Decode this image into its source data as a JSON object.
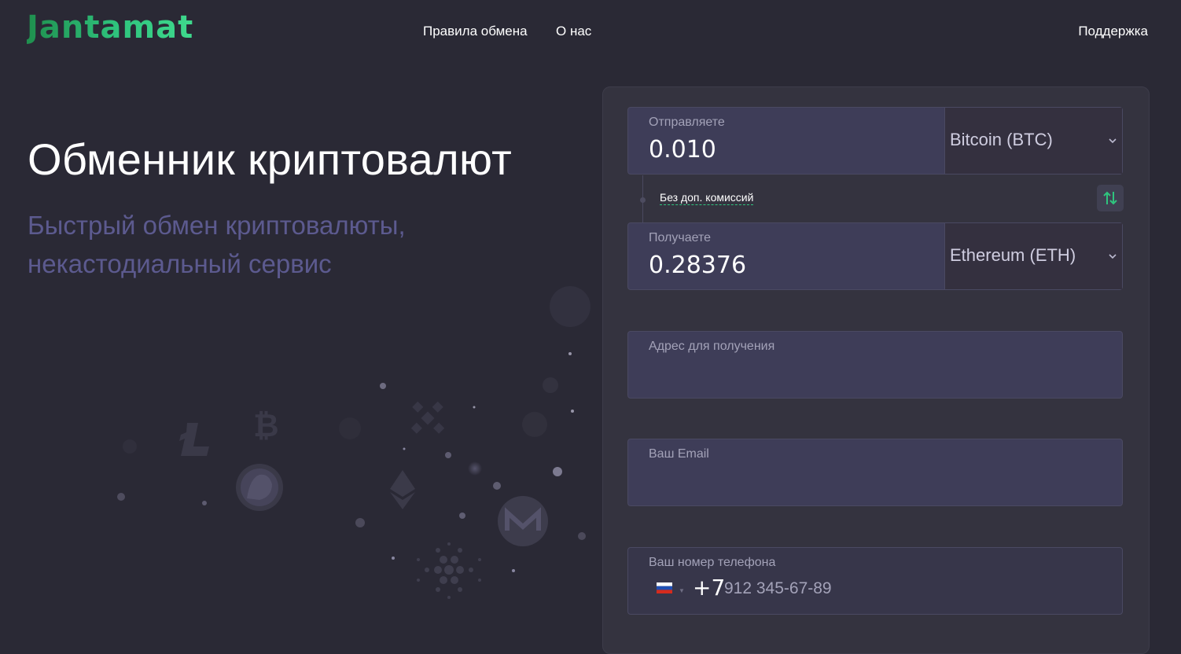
{
  "brand": {
    "logo": "Jantamat",
    "accent": "#2fc47e"
  },
  "nav": {
    "rules": "Правила обмена",
    "about": "О нас",
    "support": "Поддержка"
  },
  "hero": {
    "title": "Обменник криптовалют",
    "subtitle": "Быстрый обмен криптовалюты, некастодиальный сервис"
  },
  "exchange": {
    "send": {
      "label": "Отправляете",
      "value": "0.010",
      "currency": "Bitcoin (BTC)"
    },
    "commission": "Без доп. комиссий",
    "swap_icon": "swap-arrows-icon",
    "receive": {
      "label": "Получаете",
      "value": "0.28376",
      "currency": "Ethereum (ETH)"
    },
    "address": {
      "label": "Адрес для получения",
      "value": ""
    },
    "email": {
      "label": "Ваш Email",
      "value": ""
    },
    "phone": {
      "label": "Ваш номер телефона",
      "country_icon": "russia-flag-icon",
      "code": "+7",
      "placeholder": "912 345-67-89"
    }
  },
  "decor_icons": [
    "litecoin-icon",
    "bitcoin-icon",
    "binance-icon",
    "dogecoin-icon",
    "ethereum-icon",
    "monero-icon",
    "cardano-icon"
  ]
}
